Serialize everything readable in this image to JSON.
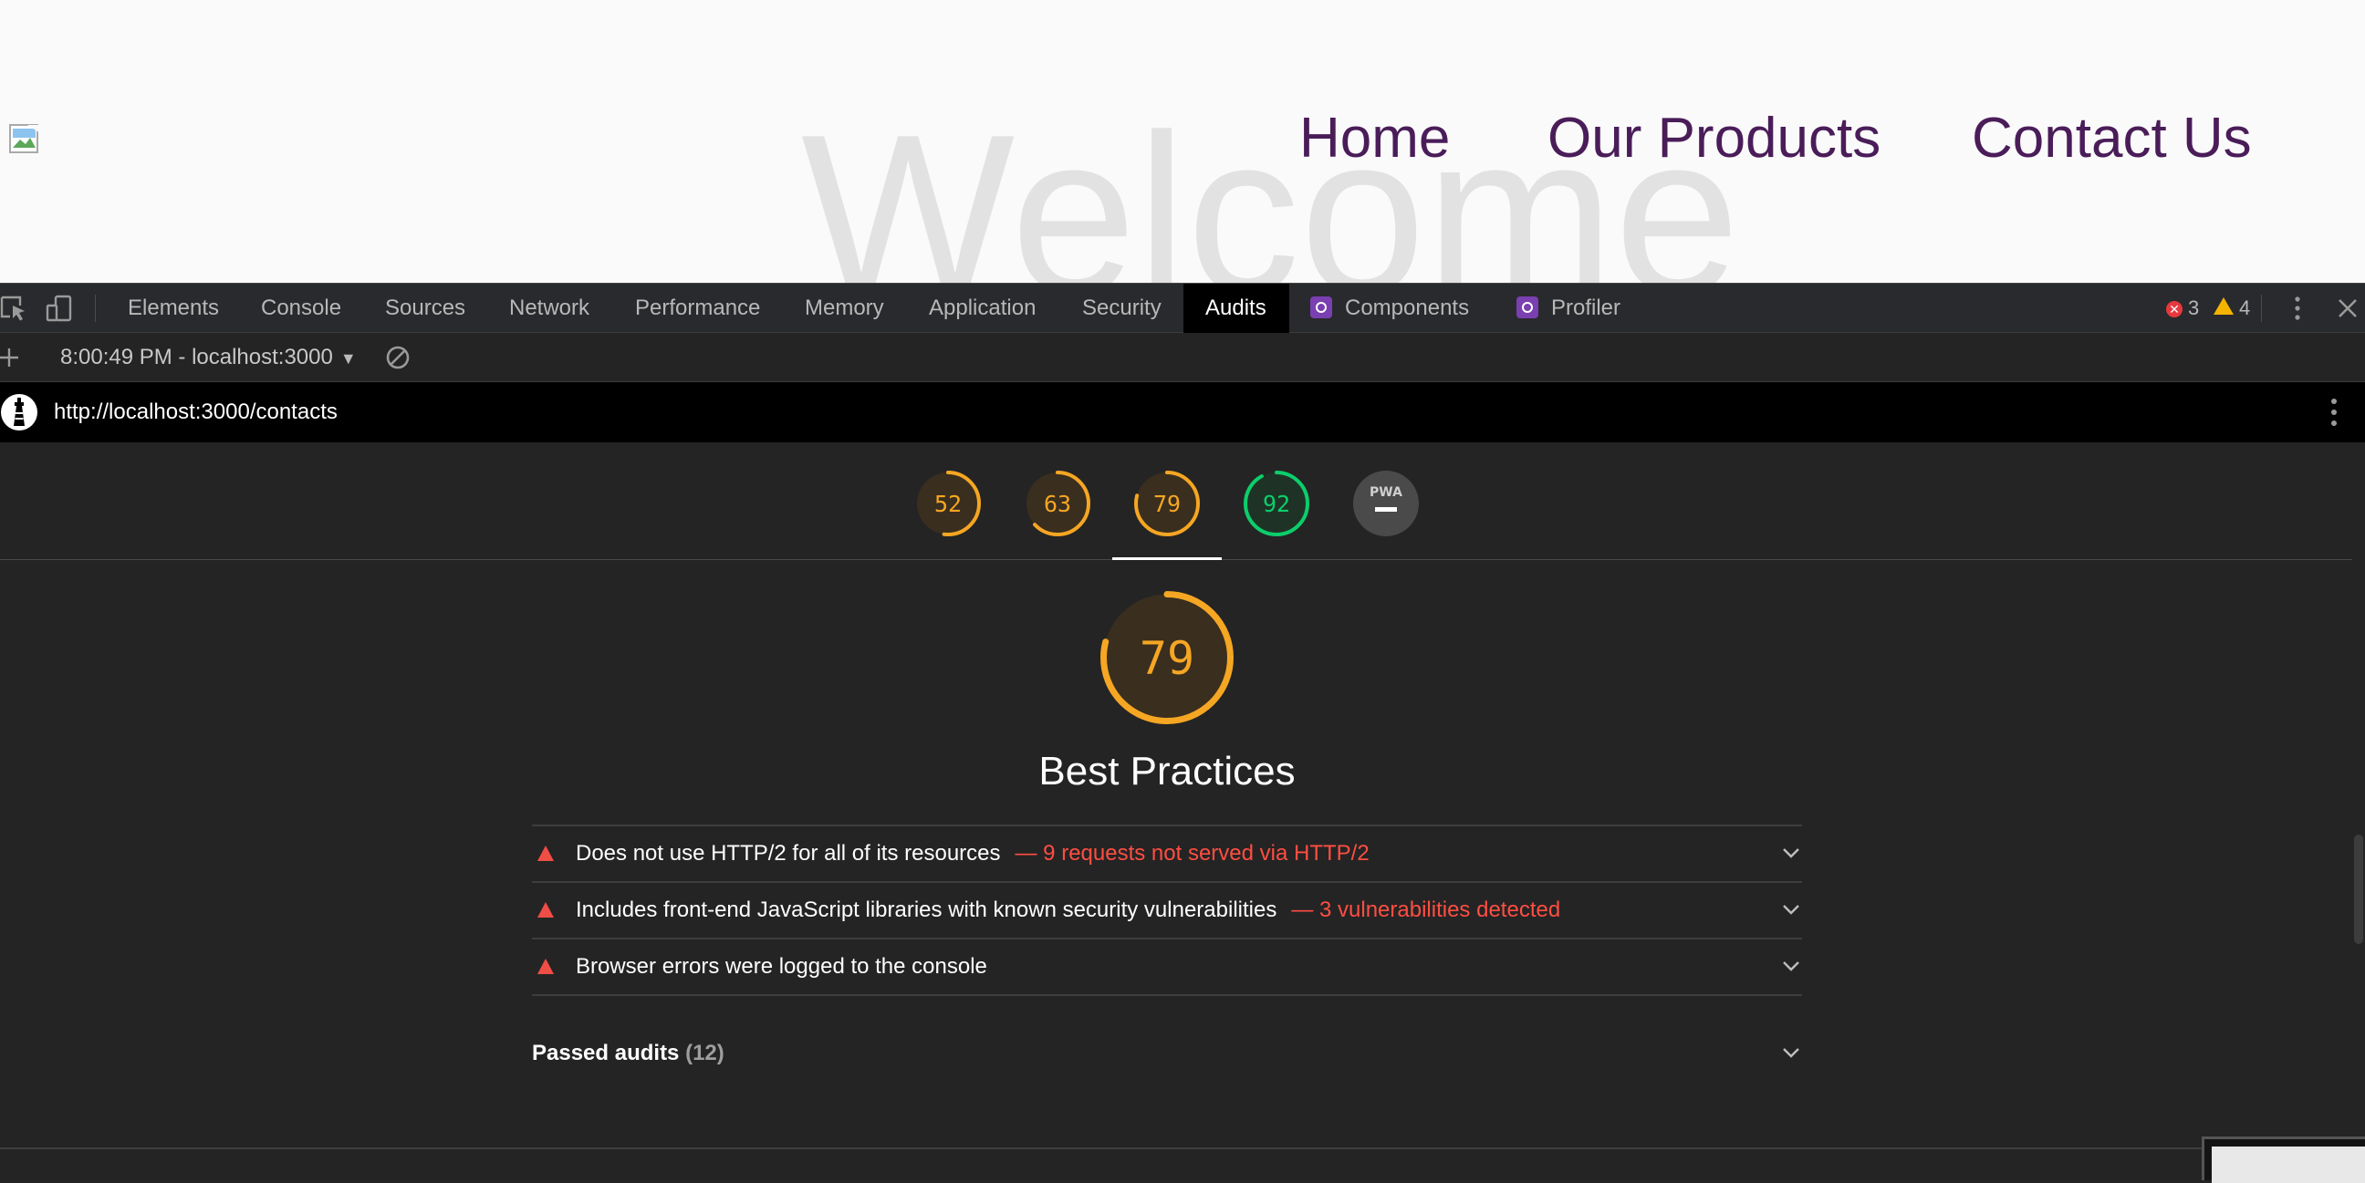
{
  "site": {
    "welcome_text": "Welcome",
    "nav": [
      {
        "label": "Home"
      },
      {
        "label": "Our Products"
      },
      {
        "label": "Contact Us"
      }
    ],
    "colors": {
      "nav": "#4a1d59",
      "welcome": "#e2e2e2",
      "background": "#fafafa"
    }
  },
  "devtools": {
    "tabs": [
      {
        "label": "Elements"
      },
      {
        "label": "Console"
      },
      {
        "label": "Sources"
      },
      {
        "label": "Network"
      },
      {
        "label": "Performance"
      },
      {
        "label": "Memory"
      },
      {
        "label": "Application"
      },
      {
        "label": "Security"
      },
      {
        "label": "Audits",
        "active": true
      },
      {
        "label": "Components",
        "icon": "react-icon"
      },
      {
        "label": "Profiler",
        "icon": "react-icon"
      }
    ],
    "error_count": "3",
    "warning_count": "4",
    "icons": [
      "inspect-icon",
      "device-toggle-icon",
      "kebab-menu-icon",
      "close-icon"
    ]
  },
  "audits_toolbar": {
    "report_select_label": "8:00:49 PM - localhost:3000",
    "icons": [
      "plus-icon",
      "caret-down-icon",
      "clear-icon"
    ]
  },
  "report": {
    "url": "http://localhost:3000/contacts",
    "gauges": [
      {
        "name": "performance",
        "score": "52",
        "value": 52,
        "color": "#f5a623"
      },
      {
        "name": "accessibility",
        "score": "63",
        "value": 63,
        "color": "#f5a623"
      },
      {
        "name": "best-practices",
        "score": "79",
        "value": 79,
        "color": "#f5a623",
        "active": true
      },
      {
        "name": "seo",
        "score": "92",
        "value": 92,
        "color": "#0cce6b"
      },
      {
        "name": "pwa",
        "score": "PWA",
        "color": "#9e9e9e"
      }
    ],
    "category": {
      "score": "79",
      "value": 79,
      "title": "Best Practices",
      "color": "#f5a623"
    },
    "audits": [
      {
        "title": "Does not use HTTP/2 for all of its resources",
        "detail": "— 9 requests not served via HTTP/2"
      },
      {
        "title": "Includes front-end JavaScript libraries with known security vulnerabilities",
        "detail": "— 3 vulnerabilities detected"
      },
      {
        "title": "Browser errors were logged to the console",
        "detail": ""
      }
    ],
    "passed": {
      "label": "Passed audits",
      "count": "(12)"
    },
    "colors": {
      "fail": "#ef4e46",
      "detail": "#ff4e42"
    }
  }
}
